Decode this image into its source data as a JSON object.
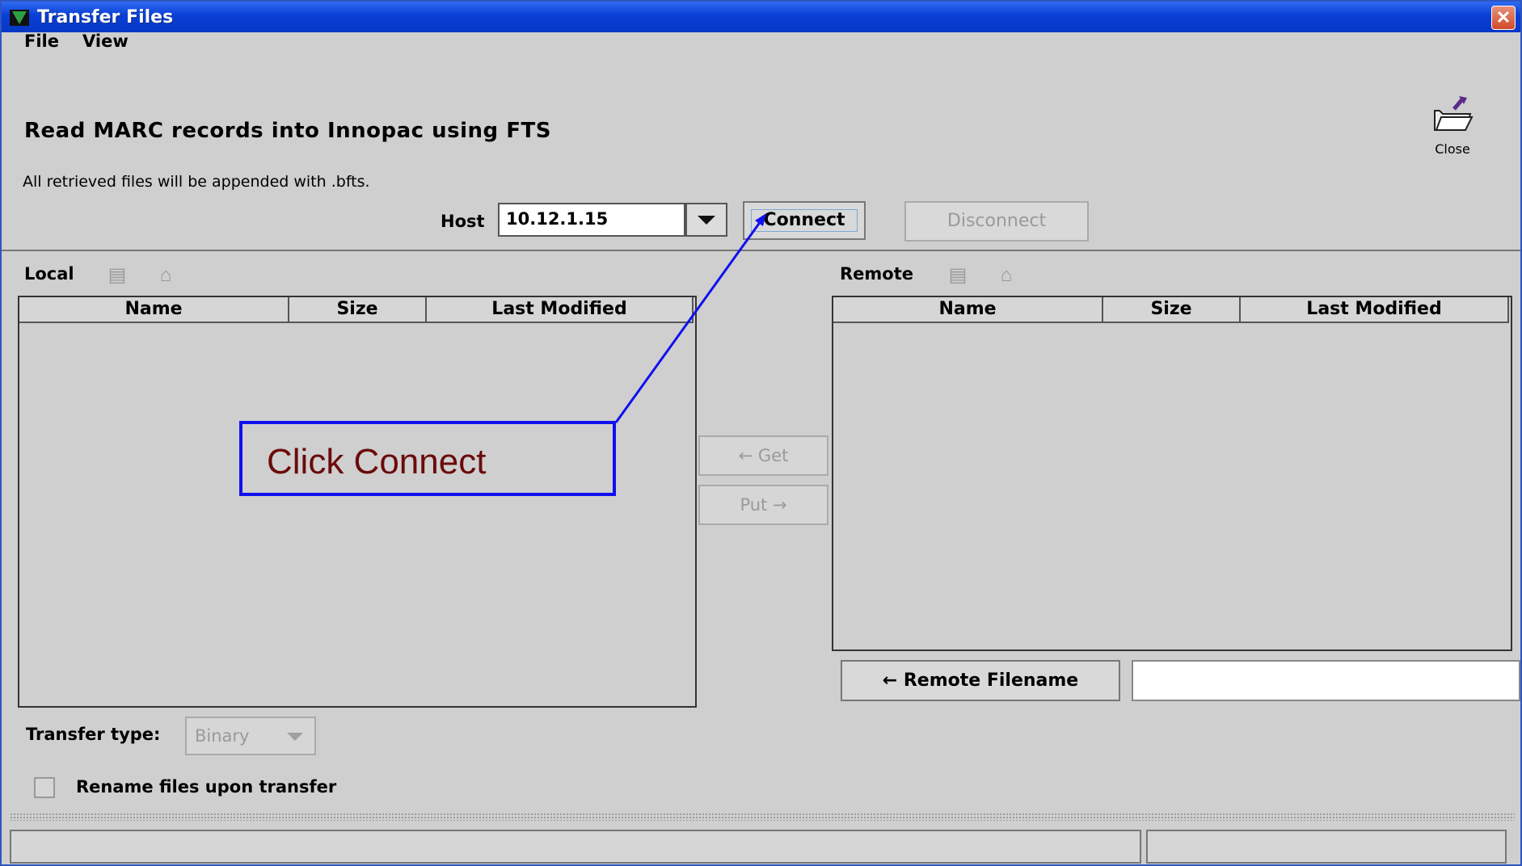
{
  "window": {
    "title": "Transfer Files"
  },
  "menu": {
    "file": "File",
    "view": "View"
  },
  "header": {
    "heading": "Read MARC records into Innopac using FTS",
    "note": "All retrieved files will be appended with .bfts.",
    "close_label": "Close"
  },
  "host": {
    "label": "Host",
    "value": "10.12.1.15"
  },
  "buttons": {
    "connect": "Connect",
    "disconnect": "Disconnect",
    "get": "← Get",
    "put": "Put →",
    "remote_filename": "← Remote Filename"
  },
  "local": {
    "label": "Local",
    "columns": [
      "Name",
      "Size",
      "Last Modified"
    ]
  },
  "remote": {
    "label": "Remote",
    "columns": [
      "Name",
      "Size",
      "Last Modified"
    ]
  },
  "transfer": {
    "label": "Transfer type:",
    "value": "Binary"
  },
  "rename": {
    "label": "Rename files upon transfer"
  },
  "callout": {
    "text": "Click  Connect"
  },
  "colors": {
    "title_bar": "#0a3fd6",
    "callout_border": "#1010f0",
    "callout_text": "#6b0a0a"
  }
}
